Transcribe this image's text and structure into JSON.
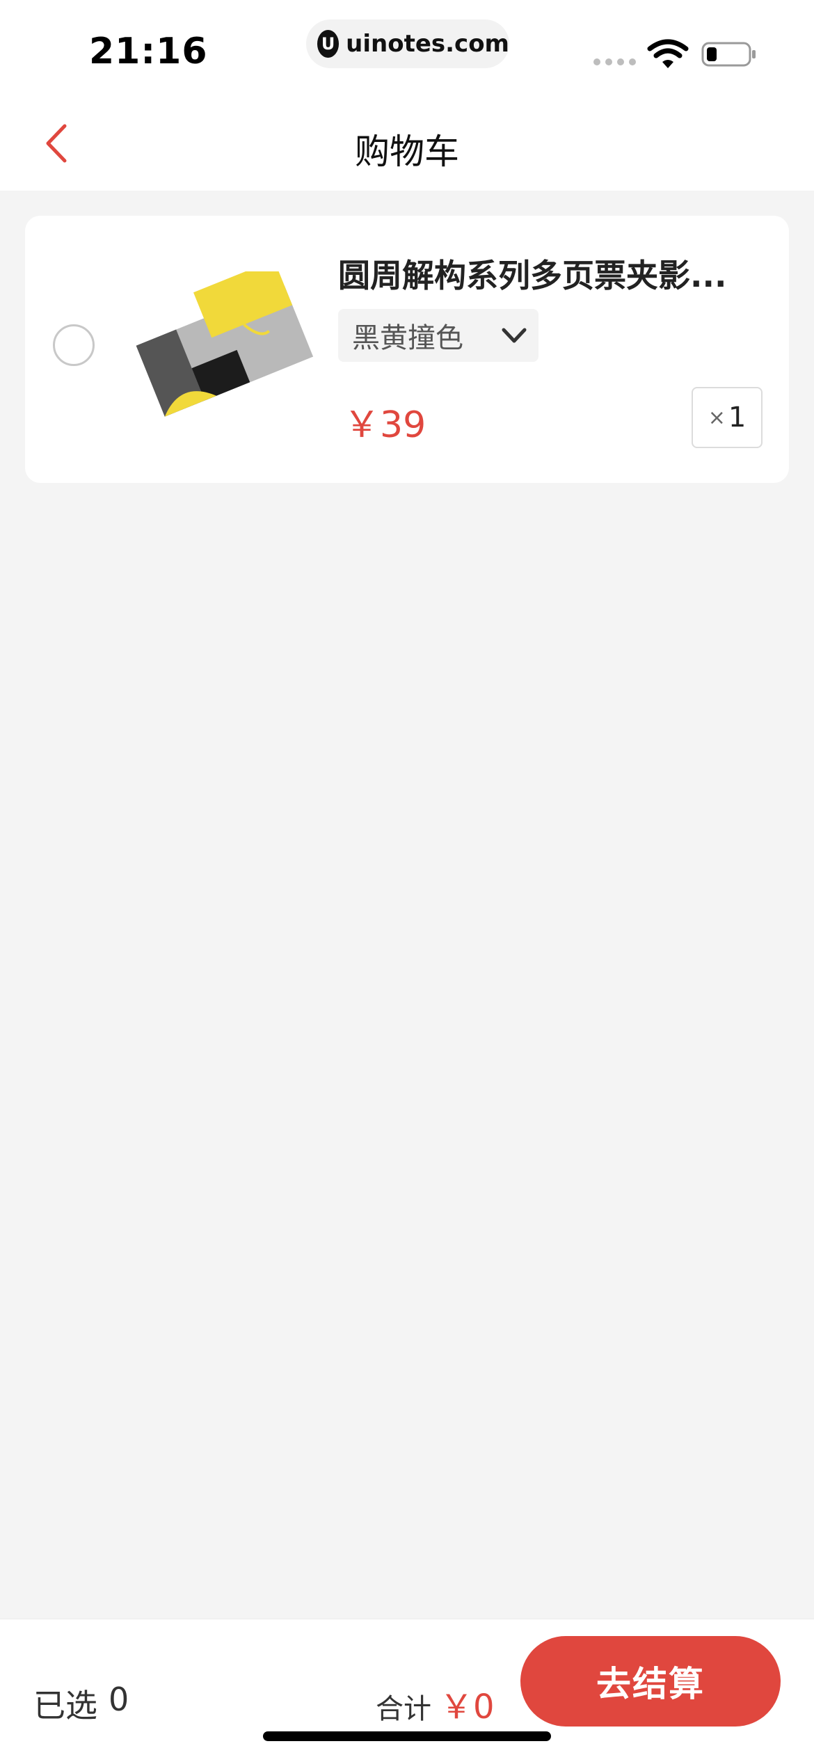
{
  "status_bar": {
    "time": "21:16",
    "url": "uinotes.com",
    "url_logo": "U",
    "icons": [
      "signal-icon",
      "wifi-icon",
      "battery-icon"
    ]
  },
  "header": {
    "title": "购物车",
    "back_icon": "chevron-left-icon"
  },
  "cart": {
    "items": [
      {
        "title": "圆周解构系列多页票夹影...",
        "variant": "黑黄撞色",
        "price": "￥39",
        "quantity_prefix": "×",
        "quantity": "1",
        "selected": false
      }
    ]
  },
  "footer": {
    "selected_label": "已选",
    "selected_count": "0",
    "total_label": "合计",
    "total_value": "￥0",
    "checkout_label": "去结算"
  },
  "colors": {
    "accent": "#e0473e",
    "background": "#f4f4f4",
    "card": "#ffffff"
  }
}
